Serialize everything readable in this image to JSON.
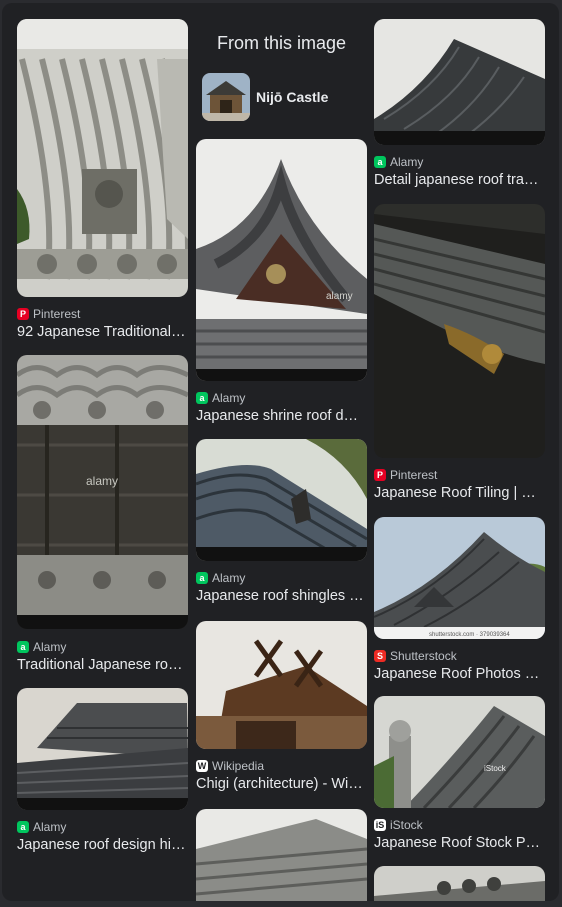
{
  "header": {
    "title": "From this image"
  },
  "entity": {
    "name": "Nijō Castle"
  },
  "results": [
    {
      "source": "Pinterest",
      "title": "92 Japanese Traditional…",
      "icon": "pinterest-icon",
      "icon_color": "#e60023"
    },
    {
      "source": "Alamy",
      "title": "Traditional Japanese ro…",
      "icon": "alamy-icon",
      "icon_color": "#00c65e"
    },
    {
      "source": "Alamy",
      "title": "Japanese roof design hi…",
      "icon": "alamy-icon",
      "icon_color": "#00c65e"
    },
    {
      "source": "Alamy",
      "title": "Japanese shrine roof d…",
      "icon": "alamy-icon",
      "icon_color": "#00c65e"
    },
    {
      "source": "Alamy",
      "title": "Japanese roof shingles …",
      "icon": "alamy-icon",
      "icon_color": "#00c65e"
    },
    {
      "source": "Wikipedia",
      "title": "Chigi (architecture) - Wi…",
      "icon": "wikipedia-icon",
      "icon_color": "#ffffff"
    },
    {
      "source": "Alamy",
      "title": "Detail japanese roof tra…",
      "icon": "alamy-icon",
      "icon_color": "#00c65e"
    },
    {
      "source": "Pinterest",
      "title": "Japanese Roof Tiling | …",
      "icon": "pinterest-icon",
      "icon_color": "#e60023"
    },
    {
      "source": "Shutterstock",
      "title": "Japanese Roof Photos …",
      "icon": "shutterstock-icon",
      "icon_color": "#ee2b24"
    },
    {
      "source": "iStock",
      "title": "Japanese Roof Stock P…",
      "icon": "istock-icon",
      "icon_color": "#ffffff"
    }
  ],
  "watermarks": {
    "alamy": "alamy",
    "shutterstock": "shutterstock.com · 379039364",
    "istock": "iStock"
  },
  "colors": {
    "background": "#202124",
    "text": "#e8eaed",
    "muted": "#bdc1c6"
  }
}
